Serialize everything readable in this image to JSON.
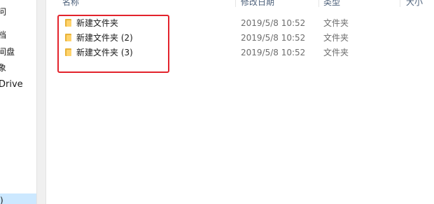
{
  "nav": {
    "items": [
      {
        "label": "问"
      },
      {
        "label": "档"
      },
      {
        "label": "间盘"
      },
      {
        "label": "象"
      },
      {
        "label": "Drive"
      },
      {
        "label": ")"
      }
    ]
  },
  "columns": {
    "name": "名称",
    "date": "修改日期",
    "type": "类型",
    "size": "大小"
  },
  "files": [
    {
      "name": "新建文件夹",
      "date": "2019/5/8 10:52",
      "type": "文件夹",
      "icon": "folder-icon"
    },
    {
      "name": "新建文件夹 (2)",
      "date": "2019/5/8 10:52",
      "type": "文件夹",
      "icon": "folder-icon"
    },
    {
      "name": "新建文件夹 (3)",
      "date": "2019/5/8 10:52",
      "type": "文件夹",
      "icon": "folder-icon"
    }
  ],
  "annotation": {
    "color": "#e3232c"
  }
}
